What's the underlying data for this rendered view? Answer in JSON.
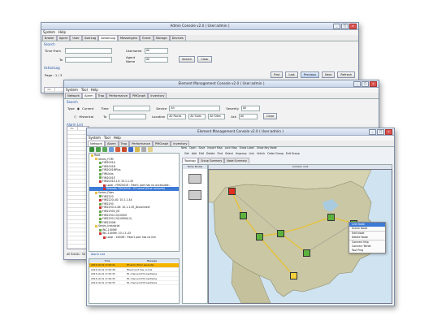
{
  "win1": {
    "title": "Admin Console v2.0 ( User:admin )",
    "menu": [
      "System",
      "Help"
    ],
    "tabs": [
      "Broker",
      "Agent",
      "User",
      "UserLog",
      "ActionLog",
      "Messengers",
      "Event",
      "Storage",
      "Devices"
    ],
    "active_tab": 4,
    "search_title": "Search",
    "time_from_label": "Time From",
    "to_label": "To",
    "username_label": "Username",
    "username_value": "All",
    "agent_name_label": "Agent Name",
    "agent_name_value": "All",
    "search_btn": "Search",
    "clear_btn": "Clear",
    "actionlog_title": "ActionLog",
    "page_label": "Page : 1 / 3",
    "nav_buttons": [
      "First",
      "Last",
      "Previous",
      "Next",
      "Refresh"
    ],
    "grid_header": "No."
  },
  "win2": {
    "title": "Element Management Console v2.0 ( User:admin )",
    "menu": [
      "System",
      "Tool",
      "Help"
    ],
    "tabs": [
      "Network",
      "Alarm",
      "Trap",
      "Performance",
      "PMGraph",
      "Inventory"
    ],
    "active_tab": 1,
    "search_title": "Search",
    "type_label": "Type",
    "current_label": "Current",
    "historical_label": "Historical",
    "time_label": "Time",
    "to_label": "To",
    "device_label": "Device",
    "device_value": "All",
    "location_label": "Location",
    "location_value": "All Racks",
    "slots_value": "All Slots",
    "sites_value": "All Sites",
    "severity_label": "Severity",
    "severity_value": "All",
    "ack_label": "Ack",
    "ack_value": "All",
    "clear_btn": "Clear",
    "alarm_list_title": "Alarm List",
    "grid_header": "No.",
    "footer_text": "All Events : 5d"
  },
  "win3": {
    "title": "Element Management Console v2.0 ( User:admin )",
    "menu": [
      "System",
      "Tool",
      "Help"
    ],
    "tabs": [
      "Network",
      "Alarm",
      "Trap",
      "Performance",
      "PMGraph",
      "Inventory"
    ],
    "active_tab": 0,
    "toolbar_top": [
      "New",
      "Open",
      "Save",
      "Import Map",
      "Lock Map",
      "Show Label",
      "Show Key Node"
    ],
    "toolbar_second": [
      "Get",
      "Add",
      "Edit",
      "Delete",
      "Find",
      "Select",
      "Ungroup",
      "Link",
      "Unlink",
      "Order Group",
      "Exit Group"
    ],
    "subtabs": [
      "Topology",
      "Group Summary",
      "Node Summary"
    ],
    "map_root_label": "Current: root",
    "temp_nodes_title": "Temp Nodes",
    "tree": [
      {
        "label": "Root",
        "level": 0,
        "color": "#e8c24a"
      },
      {
        "label": "Series_FOM",
        "level": 1,
        "color": "#e8c24a"
      },
      {
        "label": "FIM2001A",
        "level": 2,
        "color": "#6aa84f"
      },
      {
        "label": "FIM2001B",
        "level": 2,
        "color": "#6aa84f"
      },
      {
        "label": "FIM2001NPlus",
        "level": 2,
        "color": "#6aa84f"
      },
      {
        "label": "FIMLinks",
        "level": 2,
        "color": "#6aa84f"
      },
      {
        "label": "FIM2001E",
        "level": 2,
        "color": "#6aa84f"
      },
      {
        "label": "FIM2001E-10: 10.1.1.43",
        "level": 2,
        "color": "#cc3333"
      },
      {
        "label": "Local : FIM2001E : Fiber1 port has no accessible...",
        "level": 3,
        "color": "#cc3333"
      },
      {
        "label": "Remote: FIM2001E : E3 serial (Error seconds)",
        "level": 3,
        "color": "#cc3333",
        "selected": true
      },
      {
        "label": "Series_Fiber",
        "level": 1,
        "color": "#e8c24a"
      },
      {
        "label": "FIM2220",
        "level": 2,
        "color": "#6aa84f"
      },
      {
        "label": "FIM2220-4G: 10.1.1.44",
        "level": 2,
        "color": "#cc3333"
      },
      {
        "label": "FIM2250",
        "level": 2,
        "color": "#6aa84f"
      },
      {
        "label": "FIM2250-4-46: 10.1.1.45_Disconnect",
        "level": 2,
        "color": "#cc3333"
      },
      {
        "label": "FIM2250V_EE",
        "level": 2,
        "color": "#6aa84f"
      },
      {
        "label": "FIM2250-10/100V0",
        "level": 2,
        "color": "#6aa84f"
      },
      {
        "label": "FIM2250-10/100M(0.2)",
        "level": 2,
        "color": "#6aa84f"
      },
      {
        "label": "FIM2250M",
        "level": 2,
        "color": "#6aa84f"
      },
      {
        "label": "Series_Industrial",
        "level": 1,
        "color": "#e8c24a"
      },
      {
        "label": "INC-1000M",
        "level": 2,
        "color": "#6aa84f"
      },
      {
        "label": "INC-1000M: 10.1.1.43",
        "level": 2,
        "color": "#cc3333"
      },
      {
        "label": "Local : 1000M : Fiber1 port has no link",
        "level": 3,
        "color": "#cc3333"
      }
    ],
    "alarm_list_title": "Alarm List",
    "alarm_cols": [
      "Time",
      "Message"
    ],
    "alarms": [
      {
        "time": "2013-10-31 17:03:41",
        "msg": "E3 error (Error seconds)",
        "color": "#f5b400"
      },
      {
        "time": "2013-10-31 17:03:38",
        "msg": "Fiber2 port has no link",
        "color": "#ffffff"
      },
      {
        "time": "2013-10-31 17:03:35",
        "msg": "E1 channel CH1 loseframe",
        "color": "#ffffff"
      },
      {
        "time": "2013-10-31 17:04:35",
        "msg": "E1 channel CH2 loseframe",
        "color": "#ffffff"
      },
      {
        "time": "2013-10-31 17:04:35",
        "msg": "E1 channel CH3 loseframe",
        "color": "#ffffff"
      }
    ],
    "context_menu": [
      "Link Node",
      "Unlink Node",
      "Edit Node",
      "Delete Node",
      "Connect http",
      "Connect Telnet",
      "Tool Ping"
    ],
    "context_selected": 0
  },
  "colors": {
    "title_bg": "#c8d4e8",
    "map_water": "#cfe3f0",
    "map_land": "#c9c7a4",
    "node_red": "#e03020",
    "node_green": "#5cb23c",
    "node_yellow": "#f2d13a",
    "link_yellow": "#e6c23a"
  }
}
